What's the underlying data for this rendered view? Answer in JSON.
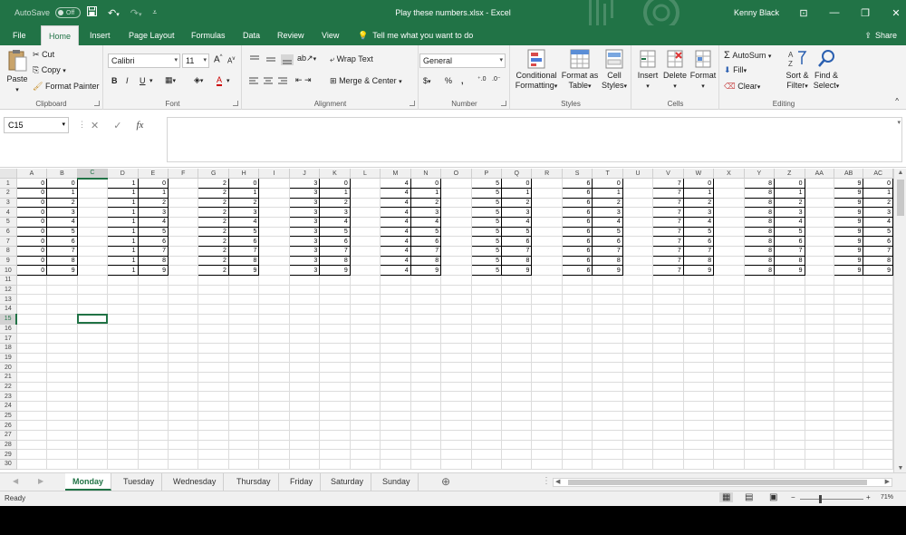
{
  "title_bar": {
    "autosave_label": "AutoSave",
    "autosave_state": "Off",
    "document_title": "Play these numbers.xlsx  -  Excel",
    "user_name": "Kenny Black"
  },
  "ribbon_tabs": [
    "File",
    "Home",
    "Insert",
    "Page Layout",
    "Formulas",
    "Data",
    "Review",
    "View"
  ],
  "active_tab": "Home",
  "tell_me": "Tell me what you want to do",
  "share": "Share",
  "clipboard": {
    "paste": "Paste",
    "cut": "Cut",
    "copy": "Copy",
    "format_painter": "Format Painter",
    "label": "Clipboard"
  },
  "font": {
    "name": "Calibri",
    "size": "11",
    "bold": "B",
    "italic": "I",
    "underline": "U",
    "label": "Font"
  },
  "alignment": {
    "wrap_text": "Wrap Text",
    "merge_center": "Merge & Center",
    "label": "Alignment"
  },
  "number": {
    "format": "General",
    "currency": "$",
    "percent": "%",
    "comma": ",",
    "label": "Number"
  },
  "styles": {
    "conditional": "Conditional",
    "formatting": "Formatting",
    "format_as": "Format as",
    "table": "Table",
    "cell": "Cell",
    "styles_word": "Styles",
    "label": "Styles"
  },
  "cells": {
    "insert": "Insert",
    "delete": "Delete",
    "format": "Format",
    "label": "Cells"
  },
  "editing": {
    "autosum": "AutoSum",
    "fill": "Fill",
    "clear": "Clear",
    "sort_a": "Sort &",
    "sort_b": "Filter",
    "find_a": "Find &",
    "find_b": "Select",
    "label": "Editing"
  },
  "name_box": "C15",
  "fx": "fx",
  "columns": [
    "A",
    "B",
    "C",
    "D",
    "E",
    "F",
    "G",
    "H",
    "I",
    "J",
    "K",
    "L",
    "M",
    "N",
    "O",
    "P",
    "Q",
    "R",
    "S",
    "T",
    "U",
    "V",
    "W",
    "X",
    "Y",
    "Z",
    "AA",
    "AB",
    "AC"
  ],
  "row_count": 30,
  "blocks": [
    {
      "col": 0,
      "value": 0
    },
    {
      "col": 3,
      "value": 1
    },
    {
      "col": 6,
      "value": 2
    },
    {
      "col": 9,
      "value": 3
    },
    {
      "col": 12,
      "value": 4
    },
    {
      "col": 15,
      "value": 5
    },
    {
      "col": 18,
      "value": 6
    },
    {
      "col": 21,
      "value": 7
    },
    {
      "col": 24,
      "value": 8
    },
    {
      "col": 27,
      "value": 9
    }
  ],
  "active_cell": {
    "row": 15,
    "col": "C"
  },
  "sheets": [
    "Monday",
    "Tuesday",
    "Wednesday",
    "Thursday",
    "Friday",
    "Saturday",
    "Sunday"
  ],
  "active_sheet": "Monday",
  "status": {
    "ready": "Ready",
    "zoom": "71%"
  }
}
